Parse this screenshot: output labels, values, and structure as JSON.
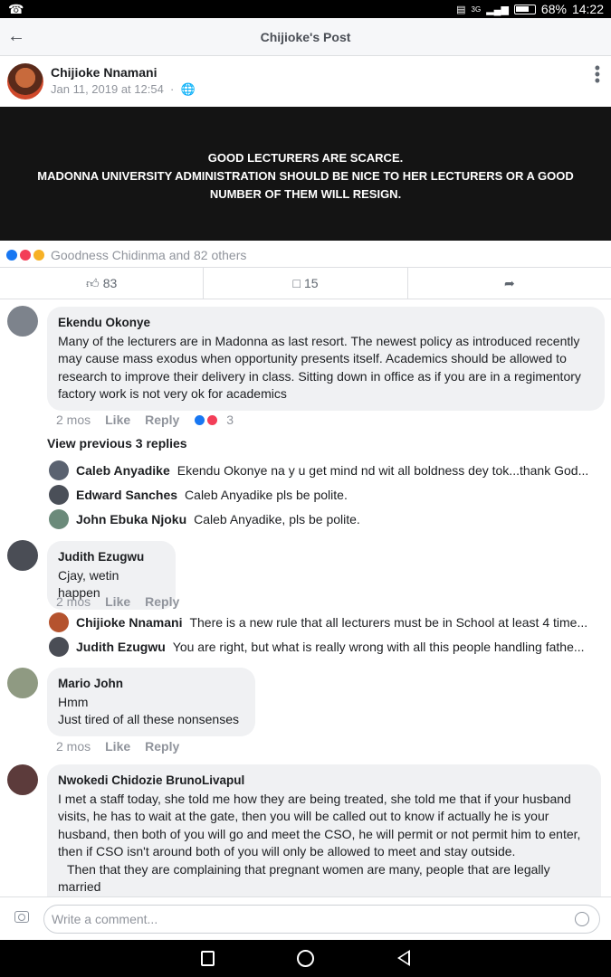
{
  "status_bar": {
    "left_icon": "whatsapp-icon",
    "network": "3G",
    "battery": "68%",
    "time": "14:22"
  },
  "header": {
    "back_icon": "arrow-left-icon",
    "title": "Chijioke's Post"
  },
  "post": {
    "author": "Chijioke Nnamani",
    "time": "Jan 11, 2019 at 12:54",
    "privacy_icon": "globe-icon",
    "banner_lines": [
      "GOOD LECTURERS ARE SCARCE.",
      "MADONNA UNIVERSITY ADMINISTRATION SHOULD BE NICE TO HER LECTURERS OR A GOOD",
      "NUMBER OF THEM WILL RESIGN."
    ],
    "reactions_text": "Goodness Chidinma and 82 others",
    "like_count": "83",
    "comment_count": "15",
    "colors": {
      "like": "#1877f2",
      "love": "#f33e58",
      "haha": "#f7b125"
    }
  },
  "comments": [
    {
      "name": "Ekendu Okonye",
      "text": "Many of the lecturers are in Madonna as last resort. The newest policy as introduced recently may cause mass exodus when opportunity presents itself. Academics should be allowed to research to improve their delivery in class. Sitting down in office as if you are in a regimentory factory work is not very ok for academics",
      "age": "2 mos",
      "like": "Like",
      "reply": "Reply",
      "reaction_count": "3"
    },
    {
      "name": "Judith Ezugwu",
      "text": "Cjay, wetin happen",
      "age": "2 mos",
      "like": "Like",
      "reply": "Reply"
    },
    {
      "name": "Mario John",
      "text_lines": [
        "Hmm",
        "Just tired of all these nonsenses"
      ],
      "age": "2 mos",
      "like": "Like",
      "reply": "Reply"
    },
    {
      "name": "Nwokedi Chidozie BrunoLivapul",
      "text": "I met a staff today, she told me how they are being treated, she told me that if your husband visits, he has to wait at the gate, then you will be called out to know if actually he is your husband, then both of you will go and meet the CSO, he will permit or not permit him to enter, then if CSO isn't around both of you will only be allowed to meet and stay outside.",
      "text2": "Then that they are complaining that pregnant women are many, people that are legally married"
    }
  ],
  "view_previous": "View previous 3 replies",
  "replies_1": [
    {
      "name": "Caleb Anyadike",
      "text": "Ekendu Okonye na y u get mind nd wit all boldness dey tok...thank God..."
    },
    {
      "name": "Edward Sanches",
      "text": "Caleb Anyadike pls be polite."
    },
    {
      "name": "John Ebuka Njoku",
      "text": "Caleb Anyadike, pls be polite."
    }
  ],
  "replies_2": [
    {
      "name": "Chijioke Nnamani",
      "text": "There is a new rule that all lecturers must be in School at least 4 time..."
    },
    {
      "name": "Judith Ezugwu",
      "text": "You are right, but what is really wrong with all this people handling fathe..."
    }
  ],
  "composer": {
    "placeholder": "Write a comment..."
  }
}
